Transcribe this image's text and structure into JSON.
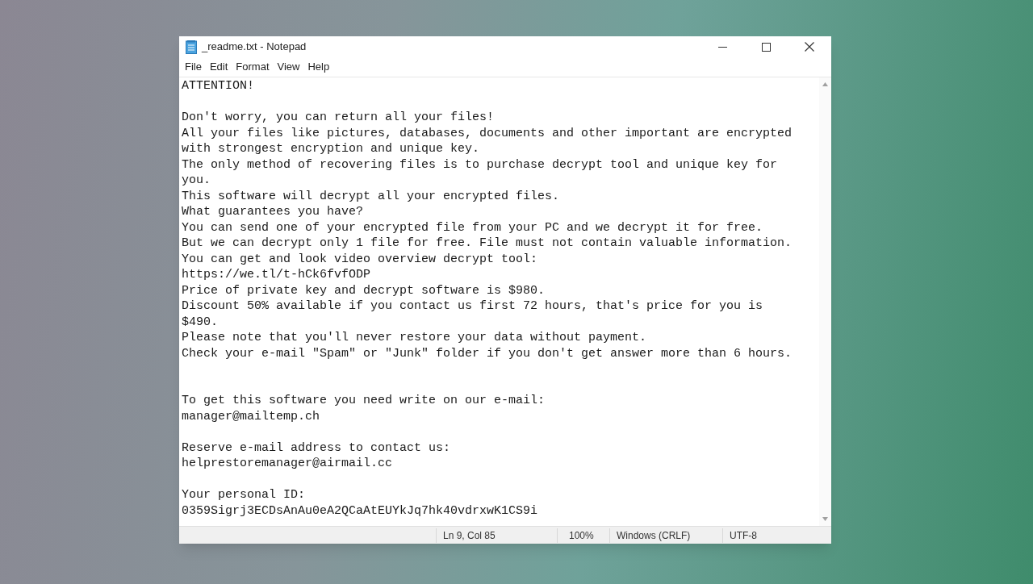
{
  "window": {
    "title": "_readme.txt - Notepad"
  },
  "menu": [
    "File",
    "Edit",
    "Format",
    "View",
    "Help"
  ],
  "document": {
    "text": "ATTENTION!\n\nDon't worry, you can return all your files!\nAll your files like pictures, databases, documents and other important are encrypted with strongest encryption and unique key.\nThe only method of recovering files is to purchase decrypt tool and unique key for you.\nThis software will decrypt all your encrypted files.\nWhat guarantees you have?\nYou can send one of your encrypted file from your PC and we decrypt it for free.\nBut we can decrypt only 1 file for free. File must not contain valuable information.\nYou can get and look video overview decrypt tool:\nhttps://we.tl/t-hCk6fvfODP\nPrice of private key and decrypt software is $980.\nDiscount 50% available if you contact us first 72 hours, that's price for you is $490.\nPlease note that you'll never restore your data without payment.\nCheck your e-mail \"Spam\" or \"Junk\" folder if you don't get answer more than 6 hours.\n\n\nTo get this software you need write on our e-mail:\nmanager@mailtemp.ch\n\nReserve e-mail address to contact us:\nhelprestoremanager@airmail.cc\n\nYour personal ID:\n0359Sigrj3ECDsAnAu0eA2QCaAtEUYkJq7hk40vdrxwK1CS9i"
  },
  "status_bar": {
    "position": "Ln 9, Col 85",
    "zoom": "100%",
    "line_ending": "Windows (CRLF)",
    "encoding": "UTF-8"
  }
}
